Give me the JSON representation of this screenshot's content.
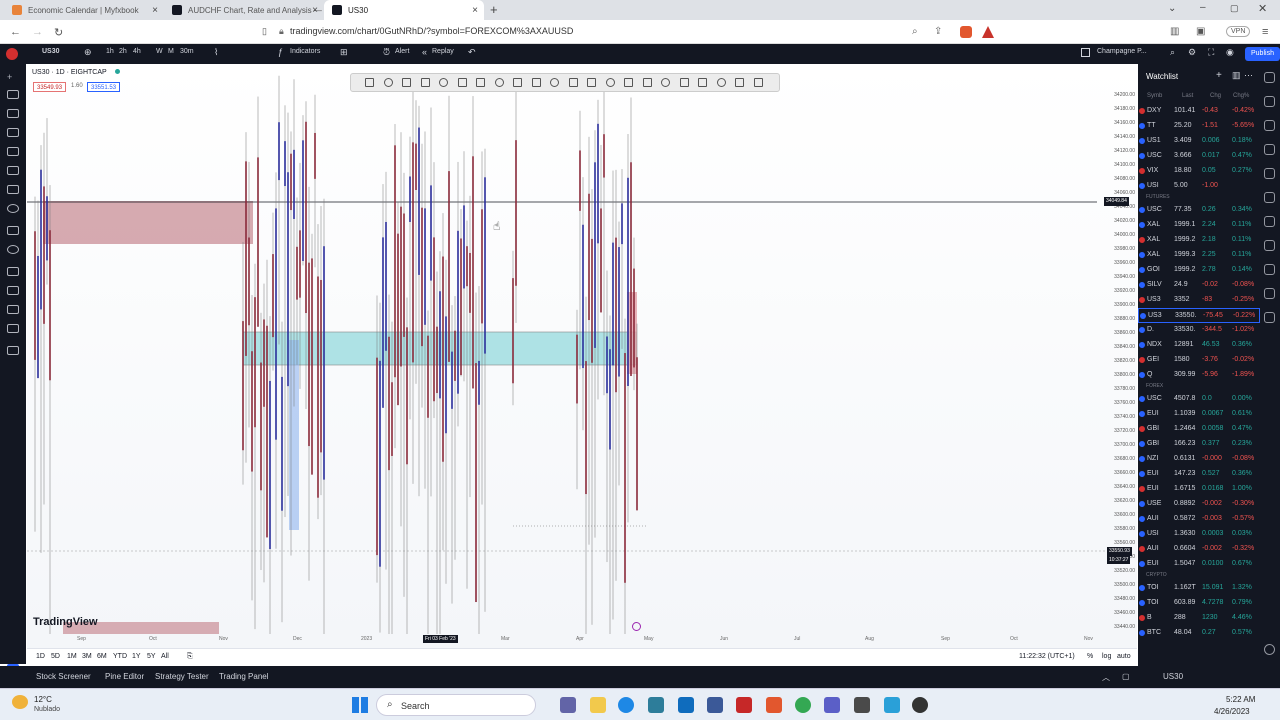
{
  "browser": {
    "tabs": [
      {
        "title": "Economic Calendar | Myfxbook",
        "color": "#e8833a"
      },
      {
        "title": "AUDCHF Chart, Rate and Analysis — T",
        "color": "#131722"
      },
      {
        "title": "US30",
        "color": "#131722"
      }
    ],
    "url": "tradingview.com/chart/0GutNRhD/?symbol=FOREXCOM%3AXAUUSD",
    "vpn": "VPN"
  },
  "toolbar": {
    "symbol": "US30",
    "intervals": [
      "1h",
      "2h",
      "4h",
      "W",
      "M",
      "30m"
    ],
    "indicators": "Indicators",
    "alert": "Alert",
    "replay": "Replay",
    "layout": "Champagne P...",
    "publish": "Publish"
  },
  "chart": {
    "title": "US30 · 1D · EIGHTCAP",
    "price_sell": "33549.93",
    "spread": "1.60",
    "price_buy": "33551.53",
    "crosshair_price": "34049.84",
    "last_price": "33550.93",
    "last_time": "10:37:27",
    "crosshair_date": "Fri 03 Feb '23",
    "y_ticks": [
      "34200.00",
      "34180.00",
      "34160.00",
      "34140.00",
      "34120.00",
      "34100.00",
      "34080.00",
      "34060.00",
      "34040.00",
      "34020.00",
      "34000.00",
      "33980.00",
      "33960.00",
      "33940.00",
      "33920.00",
      "33900.00",
      "33880.00",
      "33860.00",
      "33840.00",
      "33820.00",
      "33800.00",
      "33780.00",
      "33760.00",
      "33740.00",
      "33720.00",
      "33700.00",
      "33680.00",
      "33660.00",
      "33640.00",
      "33620.00",
      "33600.00",
      "33580.00",
      "33560.00",
      "33540.00",
      "33520.00",
      "33500.00",
      "33480.00",
      "33460.00",
      "33440.00"
    ],
    "x_ticks": [
      "Sep",
      "Oct",
      "Nov",
      "Dec",
      "2023",
      "Mar",
      "Apr",
      "May",
      "Jun",
      "Jul",
      "Aug",
      "Sep",
      "Oct",
      "Nov"
    ],
    "logo": "TradingView"
  },
  "bottom": {
    "ranges": [
      "1D",
      "5D",
      "1M",
      "3M",
      "6M",
      "YTD",
      "1Y",
      "5Y",
      "All"
    ],
    "clock": "11:22:32 (UTC+1)",
    "pct": "%",
    "log": "log",
    "auto": "auto"
  },
  "panels": [
    "Stock Screener",
    "Pine Editor",
    "Strategy Tester",
    "Trading Panel"
  ],
  "watchlist": {
    "title": "Watchlist",
    "headers": [
      "Symb",
      "Last",
      "Chg",
      "Chg%"
    ],
    "sections": [
      "FUTURES",
      "FOREX",
      "CRYPTO"
    ],
    "rows": [
      {
        "s": "DXY",
        "l": "101.41",
        "c": "-0.43",
        "p": "-0.42%",
        "up": false
      },
      {
        "s": "TT",
        "l": "25.20",
        "c": "-1.51",
        "p": "-5.65%",
        "up": false
      },
      {
        "s": "US1",
        "l": "3.409",
        "c": "0.006",
        "p": "0.18%",
        "up": true
      },
      {
        "s": "USC",
        "l": "3.666",
        "c": "0.017",
        "p": "0.47%",
        "up": true
      },
      {
        "s": "VIX",
        "l": "18.80",
        "c": "0.05",
        "p": "0.27%",
        "up": true
      },
      {
        "s": "USI",
        "l": "5.00",
        "c": "-1.00",
        "p": "",
        "up": false
      },
      {
        "s": "USC",
        "l": "77.35",
        "c": "0.26",
        "p": "0.34%",
        "up": true
      },
      {
        "s": "XAL",
        "l": "1999.1",
        "c": "2.24",
        "p": "0.11%",
        "up": true
      },
      {
        "s": "XAL",
        "l": "1999.2",
        "c": "2.18",
        "p": "0.11%",
        "up": true
      },
      {
        "s": "XAL",
        "l": "1999.3",
        "c": "2.25",
        "p": "0.11%",
        "up": true
      },
      {
        "s": "GOI",
        "l": "1999.2",
        "c": "2.78",
        "p": "0.14%",
        "up": true
      },
      {
        "s": "SILV",
        "l": "24.9",
        "c": "-0.02",
        "p": "-0.08%",
        "up": false
      },
      {
        "s": "US3",
        "l": "3352",
        "c": "-83",
        "p": "-0.25%",
        "up": false
      },
      {
        "s": "US3",
        "l": "33550.",
        "c": "-75.45",
        "p": "-0.22%",
        "up": false
      },
      {
        "s": "D.",
        "l": "33530.",
        "c": "-344.5",
        "p": "-1.02%",
        "up": false
      },
      {
        "s": "NDX",
        "l": "12891",
        "c": "46.53",
        "p": "0.36%",
        "up": true
      },
      {
        "s": "GEI",
        "l": "1580",
        "c": "-3.76",
        "p": "-0.02%",
        "up": false
      },
      {
        "s": "Q",
        "l": "309.99",
        "c": "-5.96",
        "p": "-1.89%",
        "up": false
      },
      {
        "s": "USC",
        "l": "4507.8",
        "c": "0.0",
        "p": "0.00%",
        "up": true
      },
      {
        "s": "EUI",
        "l": "1.1039",
        "c": "0.0067",
        "p": "0.61%",
        "up": true
      },
      {
        "s": "GBI",
        "l": "1.2464",
        "c": "0.0058",
        "p": "0.47%",
        "up": true
      },
      {
        "s": "GBI",
        "l": "166.23",
        "c": "0.377",
        "p": "0.23%",
        "up": true
      },
      {
        "s": "NZI",
        "l": "0.6131",
        "c": "-0.000",
        "p": "-0.08%",
        "up": false
      },
      {
        "s": "EUI",
        "l": "147.23",
        "c": "0.527",
        "p": "0.36%",
        "up": true
      },
      {
        "s": "EUI",
        "l": "1.6715",
        "c": "0.0168",
        "p": "1.00%",
        "up": true
      },
      {
        "s": "USE",
        "l": "0.8892",
        "c": "-0.002",
        "p": "-0.30%",
        "up": false
      },
      {
        "s": "AUI",
        "l": "0.5872",
        "c": "-0.003",
        "p": "-0.57%",
        "up": false
      },
      {
        "s": "USI",
        "l": "1.3630",
        "c": "0.0003",
        "p": "0.03%",
        "up": true
      },
      {
        "s": "AUI",
        "l": "0.6604",
        "c": "-0.002",
        "p": "-0.32%",
        "up": false
      },
      {
        "s": "EUI",
        "l": "1.5047",
        "c": "0.0100",
        "p": "0.67%",
        "up": true
      },
      {
        "s": "TOI",
        "l": "1.162T",
        "c": "15.091",
        "p": "1.32%",
        "up": true
      },
      {
        "s": "TOI",
        "l": "603.89",
        "c": "4.7278",
        "p": "0.79%",
        "up": true
      },
      {
        "s": "B",
        "l": "288",
        "c": "1230",
        "p": "4.46%",
        "up": true
      },
      {
        "s": "BTC",
        "l": "48.04",
        "c": "0.27",
        "p": "0.57%",
        "up": true
      }
    ],
    "footer": "US30"
  },
  "taskbar": {
    "weather_temp": "12°C",
    "weather_desc": "Nublado",
    "search": "Search",
    "time": "5:22 AM",
    "date": "4/26/2023"
  },
  "colors": {
    "up": "#26a69a",
    "down": "#ef5350",
    "bull_candle": "#2a2e9a",
    "bear_candle": "#8a2a3a",
    "zone_red": "#c98d96",
    "zone_cyan": "#8fd8dc"
  }
}
